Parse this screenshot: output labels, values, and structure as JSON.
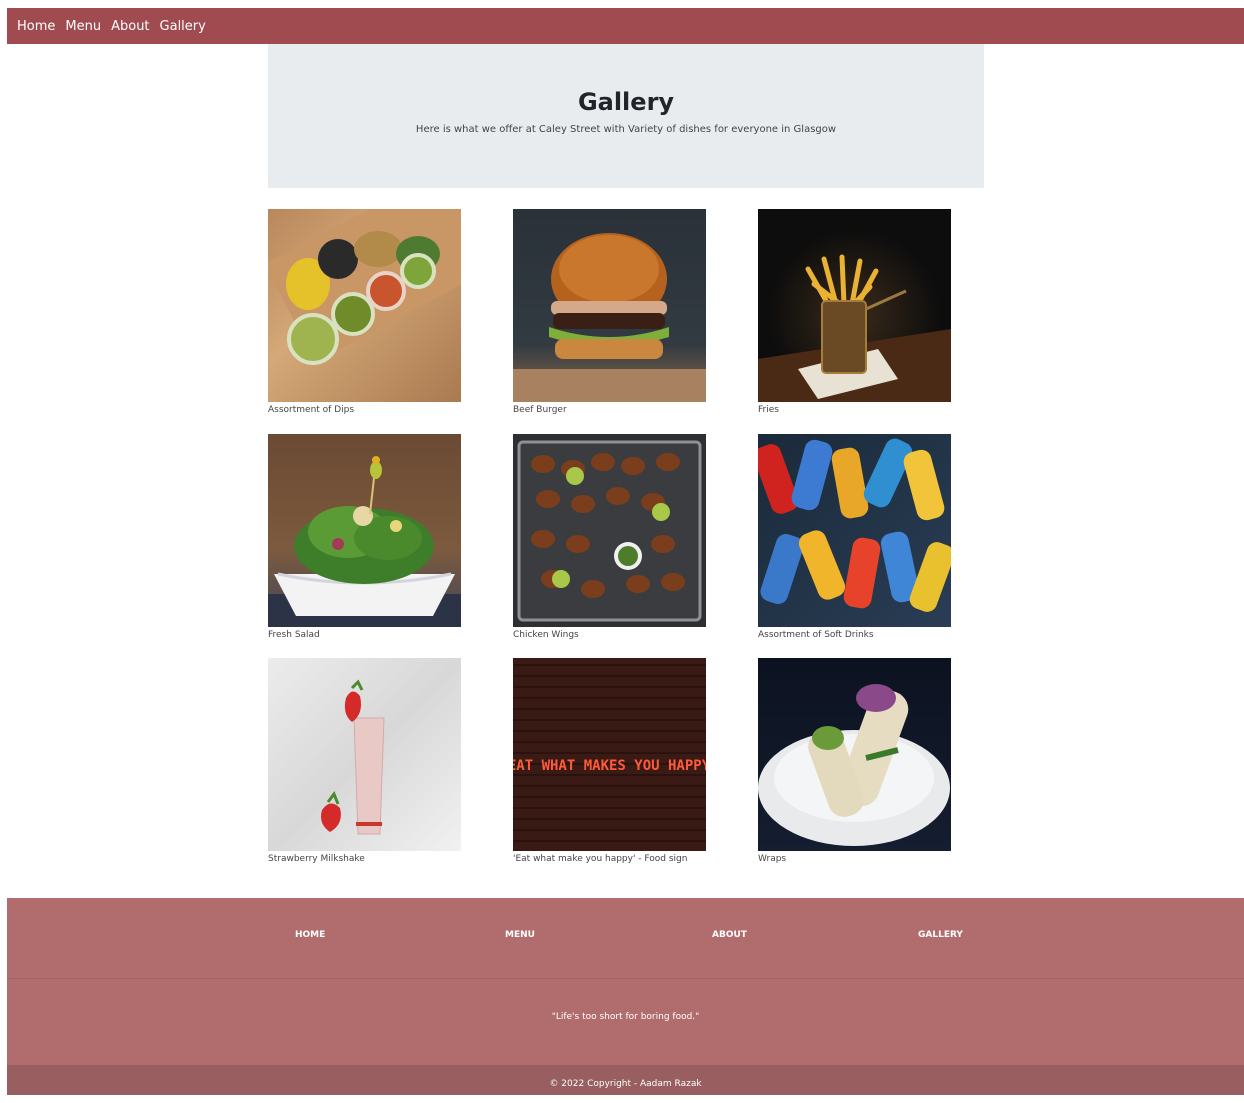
{
  "nav": {
    "items": [
      "Home",
      "Menu",
      "About",
      "Gallery"
    ]
  },
  "hero": {
    "title": "Gallery",
    "subtitle": "Here is what we offer at Caley Street with Variety of dishes for everyone in Glasgow"
  },
  "gallery": {
    "items": [
      {
        "caption": "Assortment of Dips",
        "icon": "dips-photo"
      },
      {
        "caption": "Beef Burger",
        "icon": "burger-photo"
      },
      {
        "caption": "Fries",
        "icon": "fries-photo"
      },
      {
        "caption": "Fresh Salad",
        "icon": "salad-photo"
      },
      {
        "caption": "Chicken Wings",
        "icon": "wings-photo"
      },
      {
        "caption": "Assortment of Soft Drinks",
        "icon": "soft-drinks-photo"
      },
      {
        "caption": "Strawberry Milkshake",
        "icon": "milkshake-photo"
      },
      {
        "caption": "'Eat what make you happy' - Food sign",
        "icon": "neon-sign-photo"
      },
      {
        "caption": "Wraps",
        "icon": "wraps-photo"
      }
    ]
  },
  "sign_text": "EAT WHAT MAKES YOU HAPPY",
  "footer": {
    "nav": [
      "HOME",
      "MENU",
      "ABOUT",
      "GALLERY"
    ],
    "quote": "\"Life's too short for boring food.\"",
    "copyright": "© 2022 Copyright - Aadam Razak"
  },
  "colors": {
    "nav_bg": "#a04b4f",
    "hero_bg": "#e9ecef",
    "footer_bg": "#b16d6e",
    "copyright_bg": "#985e60"
  }
}
